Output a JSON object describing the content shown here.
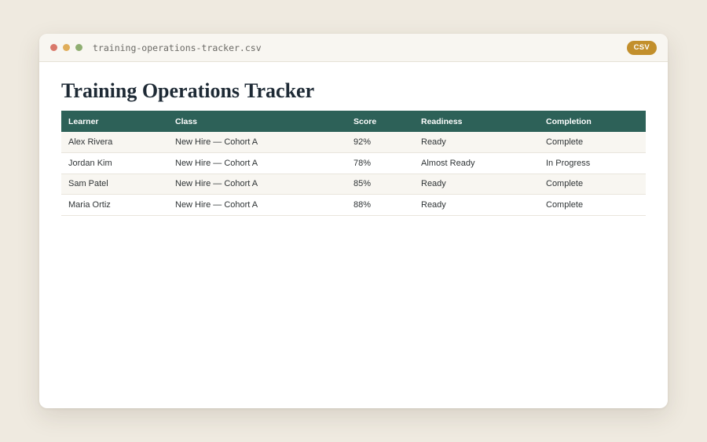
{
  "window": {
    "filename": "training-operations-tracker.csv",
    "badge": "CSV"
  },
  "page": {
    "title": "Training Operations Tracker"
  },
  "table": {
    "headers": [
      "Learner",
      "Class",
      "Score",
      "Readiness",
      "Completion"
    ],
    "rows": [
      [
        "Alex Rivera",
        "New Hire — Cohort A",
        "92%",
        "Ready",
        "Complete"
      ],
      [
        "Jordan Kim",
        "New Hire — Cohort A",
        "78%",
        "Almost Ready",
        "In Progress"
      ],
      [
        "Sam Patel",
        "New Hire — Cohort A",
        "85%",
        "Ready",
        "Complete"
      ],
      [
        "Maria Ortiz",
        "New Hire — Cohort A",
        "88%",
        "Ready",
        "Complete"
      ]
    ]
  },
  "colors": {
    "header_bg": "#2d6158",
    "badge_bg": "#c28f2c",
    "title_text": "#1e2a35"
  }
}
